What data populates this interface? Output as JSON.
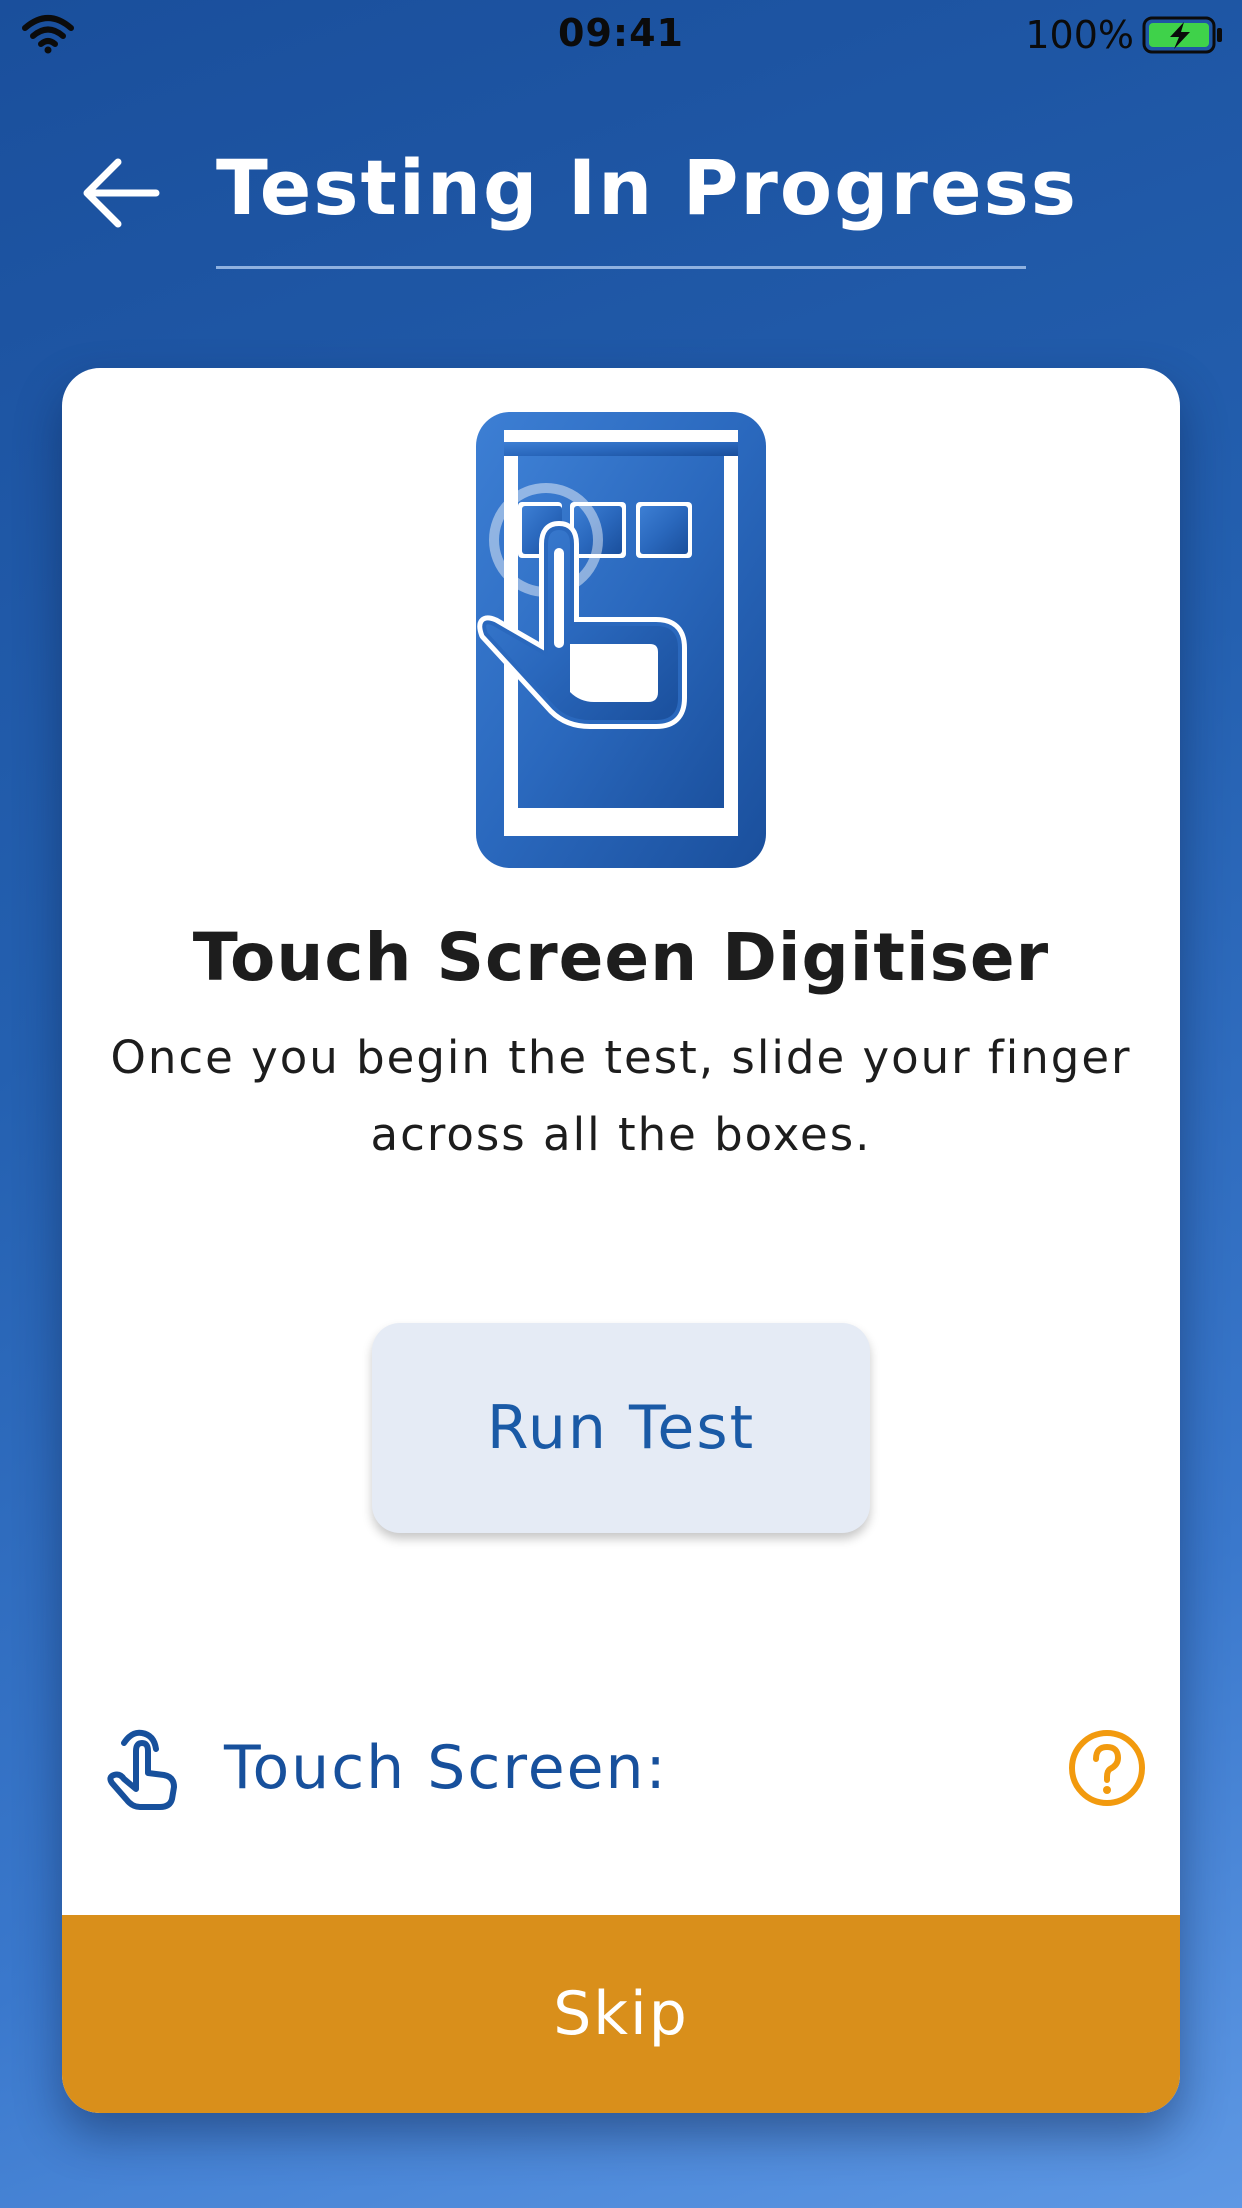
{
  "status_bar": {
    "time": "09:41",
    "battery_percent": "100%",
    "icons": [
      "wifi-icon",
      "battery-charging-icon"
    ]
  },
  "header": {
    "title": "Testing In Progress",
    "back_icon": "arrow-left-icon"
  },
  "card": {
    "illustration_icon": "phone-touch-tap-icon",
    "title": "Touch Screen Digitiser",
    "description": "Once you begin the test, slide your finger across all the boxes.",
    "run_button_label": "Run Test",
    "result_row": {
      "icon": "touch-finger-icon",
      "label": "Touch Screen:",
      "help_icon": "question-circle-icon"
    },
    "skip_label": "Skip"
  },
  "colors": {
    "background_gradient_start": "#1a4f9c",
    "background_gradient_end": "#5e98e4",
    "primary_blue": "#17509c",
    "button_background": "#e5ebf5",
    "skip_orange": "#d98f1b",
    "help_orange": "#f29a0e",
    "battery_green": "#3fd24a"
  }
}
